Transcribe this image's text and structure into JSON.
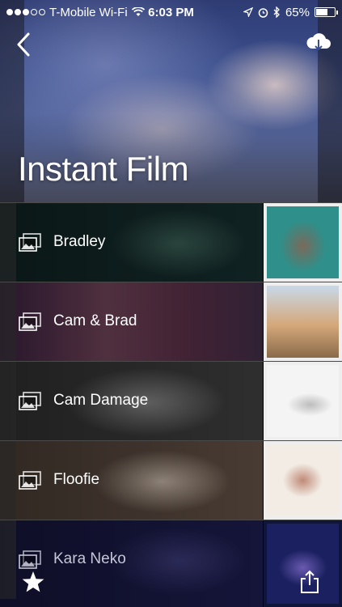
{
  "status_bar": {
    "carrier": "T-Mobile Wi-Fi",
    "time": "6:03 PM",
    "battery": "65%",
    "battery_level": 0.65,
    "signal_bars_filled": 3,
    "signal_bars_total": 5
  },
  "header": {
    "title": "Instant Film",
    "back_icon": "chevron-left-icon",
    "download_icon": "cloud-download-icon"
  },
  "albums": [
    {
      "name": "Bradley",
      "icon": "photo-stack-icon"
    },
    {
      "name": "Cam & Brad",
      "icon": "photo-stack-icon"
    },
    {
      "name": "Cam Damage",
      "icon": "photo-stack-icon"
    },
    {
      "name": "Floofie",
      "icon": "photo-stack-icon"
    },
    {
      "name": "Kara Neko",
      "icon": "photo-stack-icon"
    }
  ],
  "toolbar": {
    "favorite_icon": "star-icon",
    "share_icon": "share-icon"
  }
}
